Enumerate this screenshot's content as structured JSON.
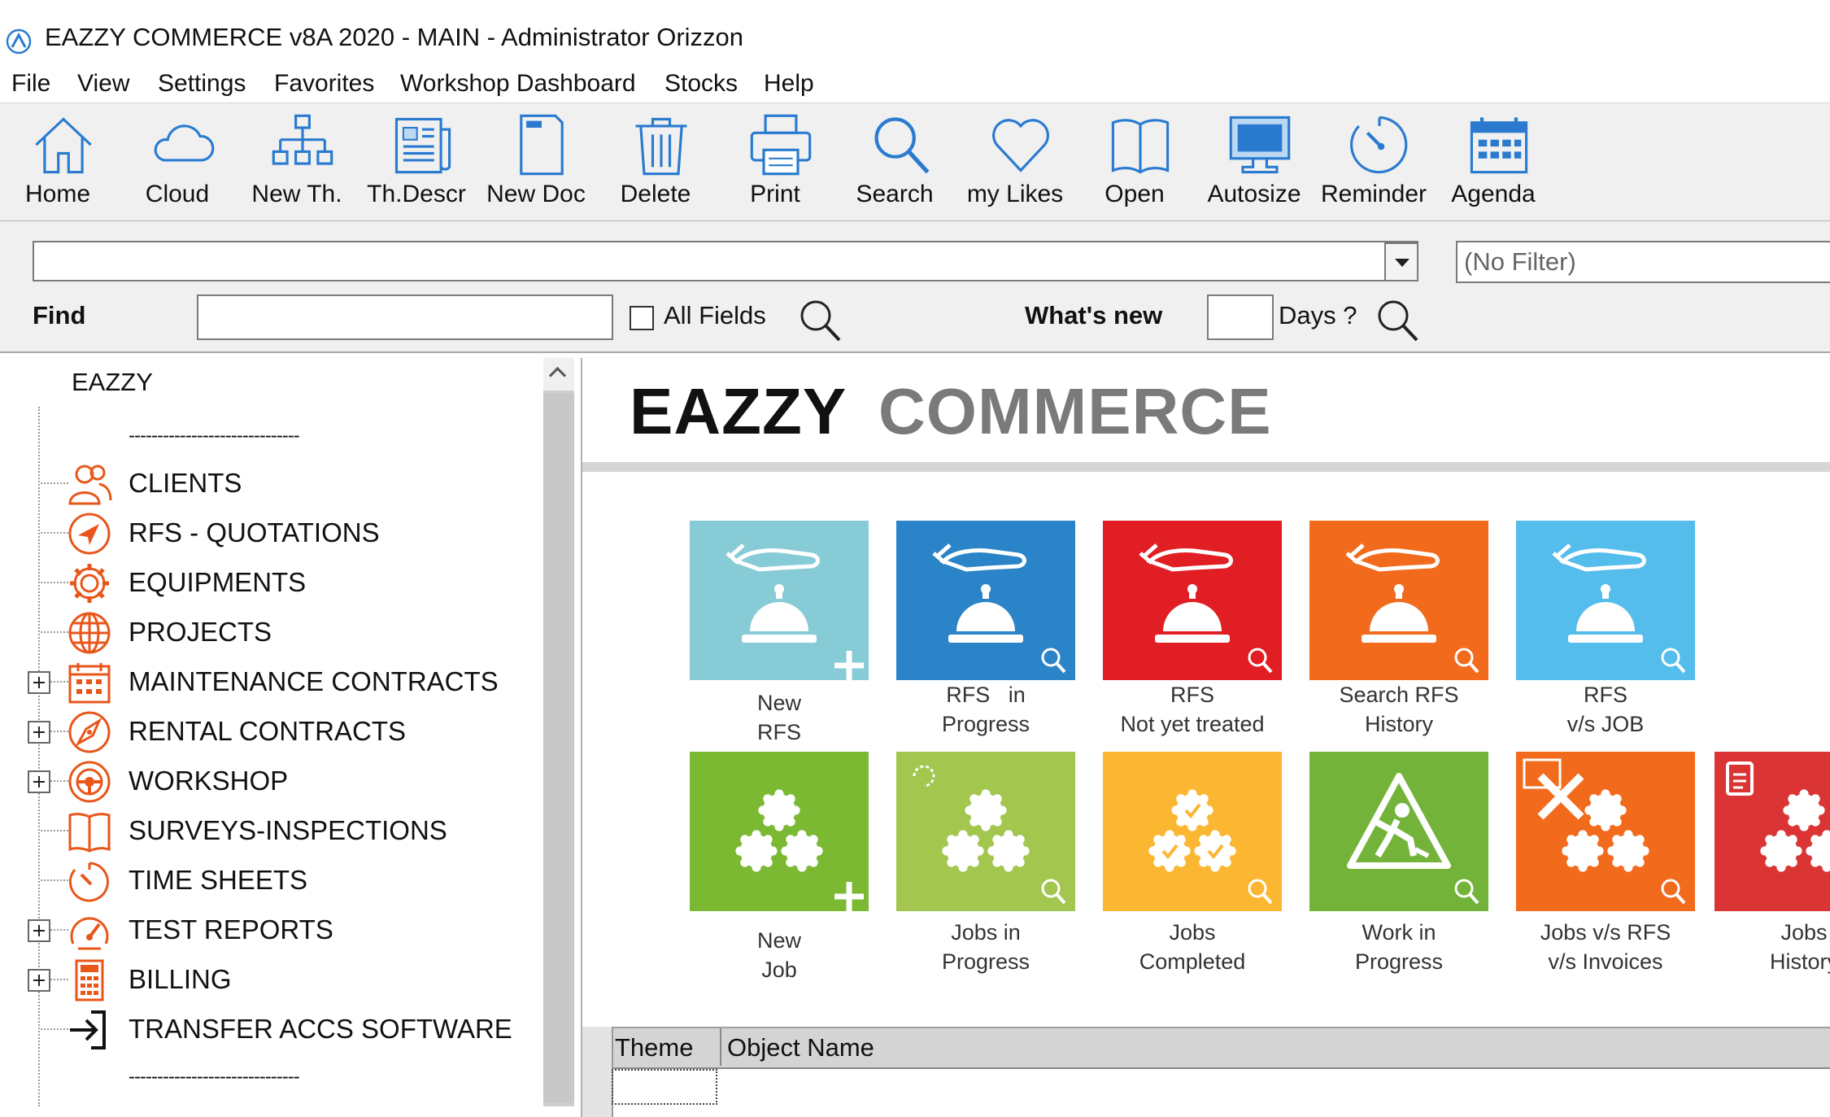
{
  "window": {
    "title": "EAZZY COMMERCE v8A 2020 - MAIN - Administrator Orizzon"
  },
  "menu": [
    "File",
    "View",
    "Settings",
    "Favorites",
    "Workshop Dashboard",
    "Stocks",
    "Help"
  ],
  "toolbar": [
    {
      "label": "Home",
      "icon": "home-icon"
    },
    {
      "label": "Cloud",
      "icon": "cloud-icon"
    },
    {
      "label": "New Th.",
      "icon": "hierarchy-icon"
    },
    {
      "label": "Th.Descr",
      "icon": "newspaper-icon"
    },
    {
      "label": "New Doc",
      "icon": "document-icon"
    },
    {
      "label": "Delete",
      "icon": "trash-icon"
    },
    {
      "label": "Print",
      "icon": "printer-icon"
    },
    {
      "label": "Search",
      "icon": "search-icon"
    },
    {
      "label": "my Likes",
      "icon": "heart-icon"
    },
    {
      "label": "Open",
      "icon": "book-icon"
    },
    {
      "label": "Autosize",
      "icon": "monitor-icon"
    },
    {
      "label": "Reminder",
      "icon": "clock-icon"
    },
    {
      "label": "Agenda",
      "icon": "calendar-icon"
    }
  ],
  "filter": {
    "combo_value": "",
    "no_filter": "(No Filter)",
    "find_label": "Find",
    "find_value": "",
    "all_fields_label": "All Fields",
    "all_fields_checked": false,
    "whats_new_label": "What's new",
    "days_value": "",
    "days_label": "Days ?"
  },
  "tree": {
    "root": "EAZZY",
    "separator": "------------------------------",
    "items": [
      {
        "label": "CLIENTS",
        "icon": "clients-icon",
        "expandable": false
      },
      {
        "label": "RFS - QUOTATIONS",
        "icon": "compass-arrow-icon",
        "expandable": false
      },
      {
        "label": "EQUIPMENTS",
        "icon": "gear-icon",
        "expandable": false
      },
      {
        "label": "PROJECTS",
        "icon": "globe-icon",
        "expandable": false
      },
      {
        "label": "MAINTENANCE CONTRACTS",
        "icon": "calendar-grid-icon",
        "expandable": true
      },
      {
        "label": "RENTAL CONTRACTS",
        "icon": "compass-icon",
        "expandable": true
      },
      {
        "label": "WORKSHOP",
        "icon": "steering-wheel-icon",
        "expandable": true
      },
      {
        "label": "SURVEYS-INSPECTIONS",
        "icon": "open-book-icon",
        "expandable": false
      },
      {
        "label": "TIME SHEETS",
        "icon": "stopwatch-icon",
        "expandable": false
      },
      {
        "label": "TEST REPORTS",
        "icon": "gauge-icon",
        "expandable": true
      },
      {
        "label": "BILLING",
        "icon": "calculator-icon",
        "expandable": true
      },
      {
        "label": "TRANSFER ACCS SOFTWARE",
        "icon": "sign-in-icon",
        "expandable": false
      }
    ]
  },
  "brand": {
    "part1": "EAZZY",
    "part2": "COMMERCE"
  },
  "tiles": [
    {
      "line1": "New",
      "line2": "RFS",
      "color": "#86cbd6",
      "icon": "service-bell-icon",
      "badge": "plus"
    },
    {
      "line1": "RFS   in",
      "line2": "Progress",
      "color": "#2b84c8",
      "icon": "service-bell-icon",
      "badge": "search"
    },
    {
      "line1": "RFS",
      "line2": "Not yet treated",
      "color": "#e21e25",
      "icon": "service-bell-icon",
      "badge": "search"
    },
    {
      "line1": "Search RFS",
      "line2": "History",
      "color": "#f26b1d",
      "icon": "service-bell-icon",
      "badge": "search"
    },
    {
      "line1": "RFS",
      "line2": "v/s JOB",
      "color": "#55bdeb",
      "icon": "service-bell-icon",
      "badge": "search"
    },
    {
      "line1": "New",
      "line2": "Job",
      "color": "#7bb932",
      "icon": "gears-icon",
      "badge": "plus"
    },
    {
      "line1": "Jobs in",
      "line2": "Progress",
      "color": "#a3c64e",
      "icon": "gears-icon",
      "badge": "search"
    },
    {
      "line1": "Jobs",
      "line2": "Completed",
      "color": "#fbb731",
      "icon": "gears-check-icon",
      "badge": "search"
    },
    {
      "line1": "Work in",
      "line2": "Progress",
      "color": "#74b33a",
      "icon": "road-work-icon",
      "badge": "search"
    },
    {
      "line1": "Jobs v/s RFS",
      "line2": "v/s Invoices",
      "color": "#f26b1d",
      "icon": "gears-cross-icon",
      "badge": "search"
    },
    {
      "line1": "Jobs",
      "line2": "History",
      "color": "#db3434",
      "icon": "gears-clipboard-icon",
      "badge": "none"
    }
  ],
  "grid": {
    "columns": [
      "Theme",
      "Object Name"
    ]
  }
}
